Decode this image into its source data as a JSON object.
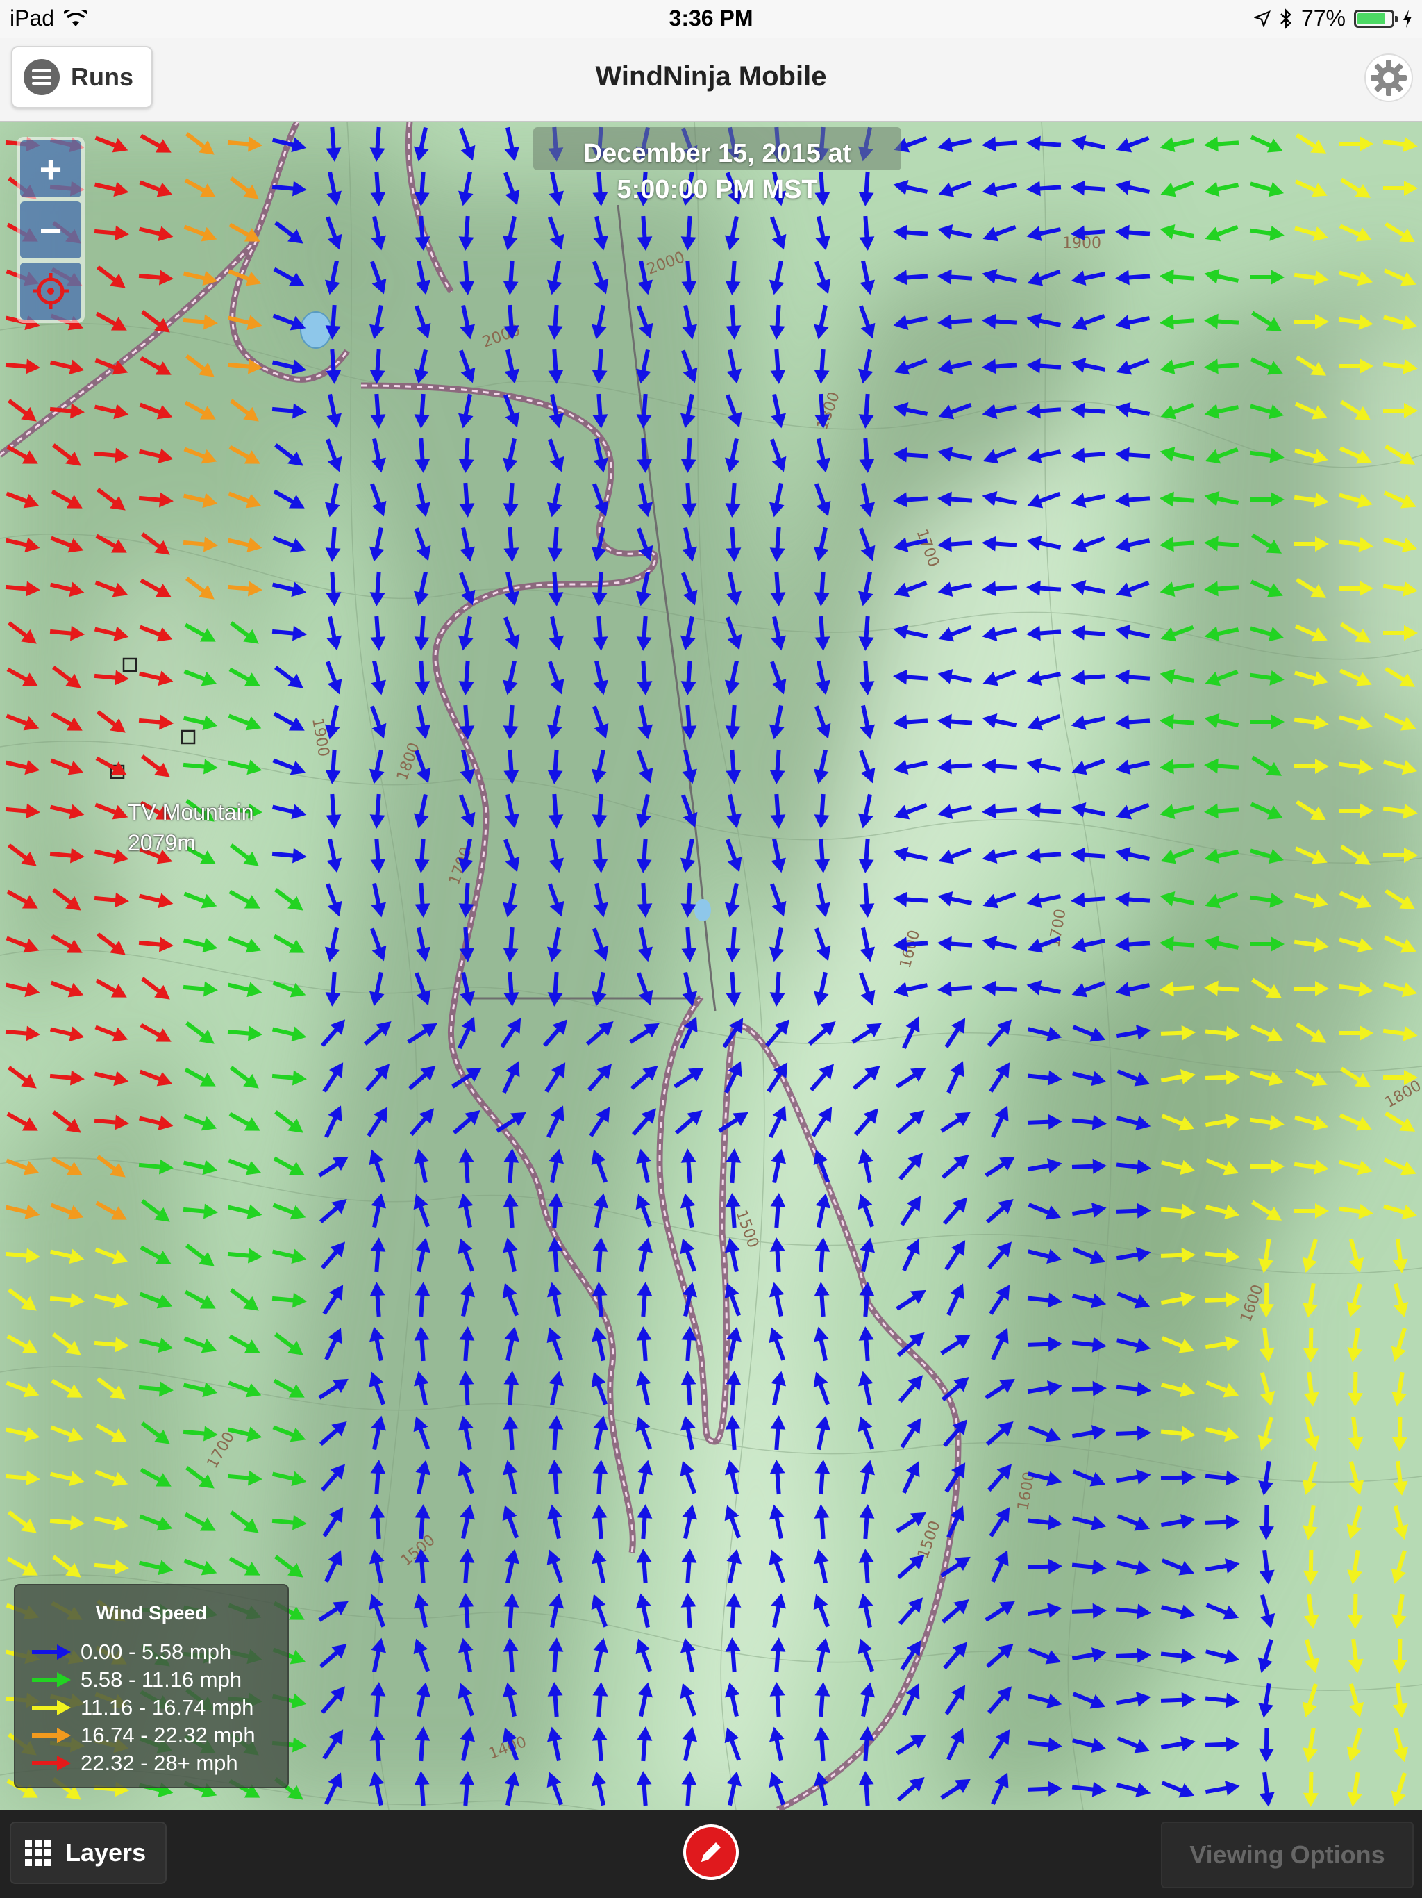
{
  "status_bar": {
    "device": "iPad",
    "time": "3:36 PM",
    "battery_percent": "77%",
    "battery_level": 0.77
  },
  "nav": {
    "runs_label": "Runs",
    "title": "WindNinja Mobile",
    "settings_icon": "gear-icon",
    "menu_icon": "hamburger-icon"
  },
  "map": {
    "timestamp_line1": "December 15, 2015 at",
    "timestamp_line2": "5:00:00 PM MST",
    "peak_name": "TV Mountain",
    "peak_elevation": "2079m",
    "contour_labels": [
      "2000",
      "1900",
      "1800",
      "1700",
      "1600",
      "1500",
      "1400"
    ],
    "zoom_in": "+",
    "zoom_out": "−",
    "locate_icon": "crosshair-icon"
  },
  "legend": {
    "title": "Wind Speed",
    "items": [
      {
        "label": "0.00 - 5.58 mph",
        "color": "#1212e6"
      },
      {
        "label": "5.58 - 11.16 mph",
        "color": "#22d322"
      },
      {
        "label": "11.16 - 16.74 mph",
        "color": "#f2f21e"
      },
      {
        "label": "16.74 - 22.32 mph",
        "color": "#f29a1e"
      },
      {
        "label": "22.32 - 28+ mph",
        "color": "#e61a1a"
      }
    ]
  },
  "bottom_bar": {
    "layers_label": "Layers",
    "viewing_options_label": "Viewing Options",
    "edit_icon": "pencil-icon"
  }
}
